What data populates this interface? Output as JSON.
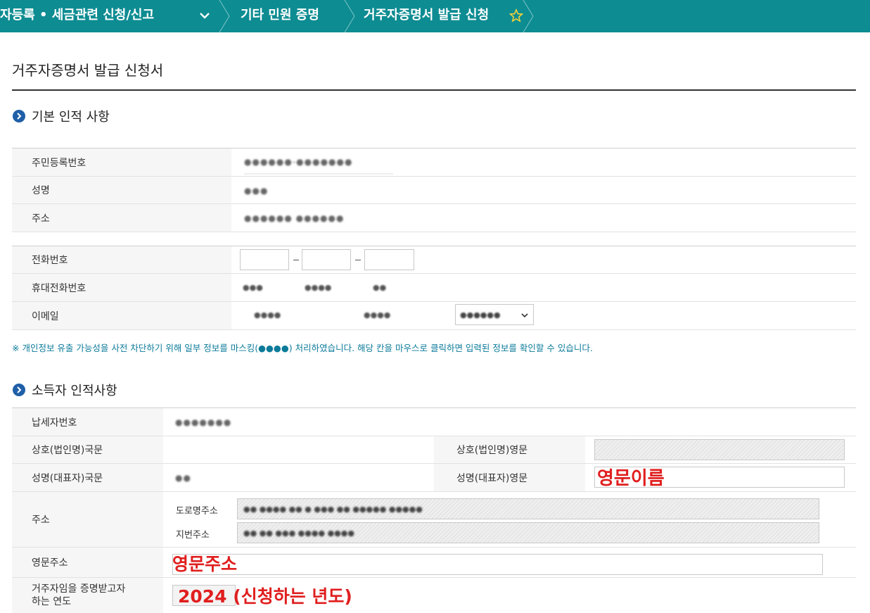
{
  "breadcrumb": {
    "level1": "자등록 • 세금관련 신청/신고",
    "level2": "기타 민원 증명",
    "level3": "거주자증명서 발급 신청"
  },
  "page_title": "거주자증명서 발급 신청서",
  "section_basic": {
    "title": "기본 인적 사항",
    "rows": [
      {
        "label": "주민등록번호",
        "value": "●●●●●●-●●●●●●●"
      },
      {
        "label": "성명",
        "value": "●●●"
      },
      {
        "label": "주소",
        "value": "●●●●●● ●●●●●●"
      }
    ],
    "phone_label": "전화번호",
    "mobile_label": "휴대전화번호",
    "mobile_values": [
      "●●●",
      "●●●●",
      "●●"
    ],
    "email_label": "이메일",
    "email_values": [
      "●●●●",
      "●●●●"
    ],
    "email_domain_select": "●●●●●●"
  },
  "notice": "※ 개인정보 유출 가능성을 사전 차단하기 위해 일부 정보를 마스킹(●●●●) 처리하였습니다. 해당 칸을 마우스로 클릭하면 입력된 정보를 확인할 수 있습니다.",
  "section_income": {
    "title": "소득자 인적사항",
    "taxpayer_no_label": "납세자번호",
    "taxpayer_no_value": "●●●●●●●",
    "company_kr_label": "상호(법인명)국문",
    "company_en_label": "상호(법인명)영문",
    "name_kr_label": "성명(대표자)국문",
    "name_kr_value": "●●",
    "name_en_label": "성명(대표자)영문",
    "name_en_annotation": "영문이름",
    "address_label": "주소",
    "road_address_label": "도로명주소",
    "road_address_value": "●● ●●●● ●● ● ●●● ●● ●●●●● ●●●●●",
    "lot_address_label": "지번주소",
    "lot_address_value": "●● ●● ●●● ●●●● ●●●●",
    "english_address_label": "영문주소",
    "english_address_annotation": "영문주소",
    "year_label_line1": "거주자임을 증명받고자",
    "year_label_line2": "하는 연도",
    "year_annotation": "2024 (신청하는 년도)"
  },
  "colors": {
    "topbar": "#0d8c92",
    "annotation": "#e01e1e",
    "notice": "#0c7b9a"
  },
  "icons": [
    "chevron-down-icon",
    "star-outline-icon",
    "arrow-circle-bullet-icon"
  ]
}
